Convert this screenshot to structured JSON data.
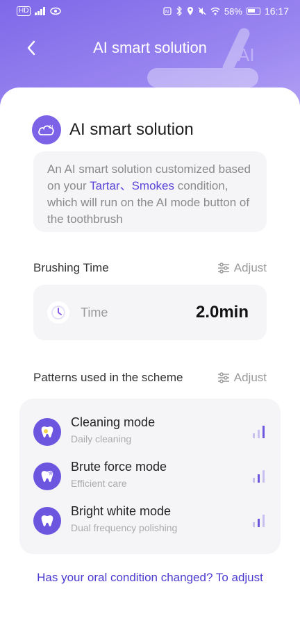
{
  "status_bar": {
    "left_icons": [
      "hd-icon",
      "signal-icon",
      "eye-icon"
    ],
    "right_icons": [
      "nfc-icon",
      "bluetooth-icon",
      "location-icon",
      "mute-icon",
      "wifi-icon"
    ],
    "battery": "58%",
    "time": "16:17"
  },
  "nav": {
    "title": "AI smart solution",
    "back_icon": "chevron-left-icon"
  },
  "header_decoration_text": "AI",
  "section_title": "AI smart solution",
  "description": {
    "prefix": "An AI smart solution customized based on your ",
    "highlight": "Tartar、Smokes",
    "suffix": " condition, which will run on the AI mode button of the toothbrush"
  },
  "brushing": {
    "label": "Brushing Time",
    "adjust_label": "Adjust",
    "time_label": "Time",
    "time_value": "2.0min"
  },
  "patterns": {
    "label": "Patterns used in the scheme",
    "adjust_label": "Adjust",
    "modes": [
      {
        "name": "Cleaning mode",
        "sub": "Daily cleaning",
        "icon": "tooth-sparkle-icon",
        "level": 3
      },
      {
        "name": "Brute force mode",
        "sub": "Efficient care",
        "icon": "tooth-star-icon",
        "level": 2
      },
      {
        "name": "Bright white mode",
        "sub": "Dual frequency polishing",
        "icon": "tooth-icon",
        "level": 2
      }
    ]
  },
  "bottom_link": "Has your oral condition changed? To adjust",
  "colors": {
    "accent": "#6c55df",
    "header_gradient_start": "#7e68e8",
    "link": "#4b3ad0"
  }
}
